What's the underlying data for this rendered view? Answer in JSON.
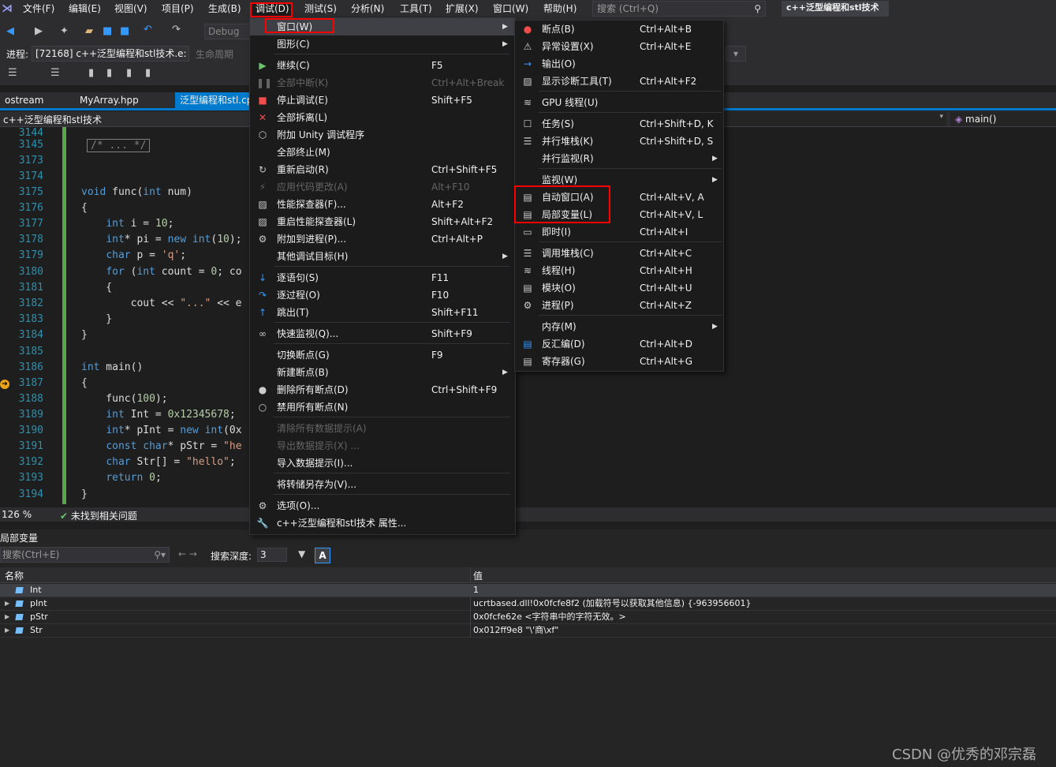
{
  "menubar": {
    "items": [
      "文件(F)",
      "编辑(E)",
      "视图(V)",
      "项目(P)",
      "生成(B)",
      "调试(D)",
      "测试(S)",
      "分析(N)",
      "工具(T)",
      "扩展(X)",
      "窗口(W)",
      "帮助(H)"
    ],
    "search_placeholder": "搜索 (Ctrl+Q)",
    "title": "c++泛型编程和stl技术"
  },
  "toolbar": {
    "config": "Debug",
    "process_label": "进程:",
    "process_value": "[72168] c++泛型编程和stl技术.e:",
    "lifecycle": "生命周期"
  },
  "tabs": [
    "ostream",
    "MyArray.hpp",
    "泛型编程和stl.cp"
  ],
  "nav": {
    "left": "c++泛型编程和stl技术",
    "right": "main()"
  },
  "editor": {
    "lines": [
      {
        "n": "3144",
        "t": ""
      },
      {
        "n": "3145",
        "t": "/* ... */"
      },
      {
        "n": "3173",
        "t": ""
      },
      {
        "n": "3174",
        "t": ""
      },
      {
        "n": "3175",
        "t": "void func(int num)"
      },
      {
        "n": "3176",
        "t": "{"
      },
      {
        "n": "3177",
        "t": "    int i = 10;"
      },
      {
        "n": "3178",
        "t": "    int* pi = new int(10);"
      },
      {
        "n": "3179",
        "t": "    char p = 'q';"
      },
      {
        "n": "3180",
        "t": "    for (int count = 0; co"
      },
      {
        "n": "3181",
        "t": "    {"
      },
      {
        "n": "3182",
        "t": "        cout << \"...\" << e"
      },
      {
        "n": "3183",
        "t": "    }"
      },
      {
        "n": "3184",
        "t": "}"
      },
      {
        "n": "3185",
        "t": ""
      },
      {
        "n": "3186",
        "t": "int main()"
      },
      {
        "n": "3187",
        "t": "{"
      },
      {
        "n": "3188",
        "t": "    func(100);"
      },
      {
        "n": "3189",
        "t": "    int Int = 0x12345678;"
      },
      {
        "n": "3190",
        "t": "    int* pInt = new int(0x"
      },
      {
        "n": "3191",
        "t": "    const char* pStr = \"he"
      },
      {
        "n": "3192",
        "t": "    char Str[] = \"hello\";"
      },
      {
        "n": "3193",
        "t": "    return 0;"
      },
      {
        "n": "3194",
        "t": "}"
      }
    ]
  },
  "status": {
    "zoom": "126 %",
    "issues": "未找到相关问题"
  },
  "panel": {
    "title": "局部变量",
    "search_placeholder": "搜索(Ctrl+E)",
    "depth_label": "搜索深度:",
    "depth_value": "3",
    "col_name": "名称",
    "col_value": "值",
    "rows": [
      {
        "name": "Int",
        "value": "1"
      },
      {
        "name": "pInt",
        "value": "ucrtbased.dll!0x0fcfe8f2 (加载符号以获取其他信息) {-963956601}"
      },
      {
        "name": "pStr",
        "value": "0x0fcfe62e <字符串中的字符无效。>"
      },
      {
        "name": "Str",
        "value": "0x012ff9e8 \"\\'商\\xf\""
      }
    ]
  },
  "debug_menu": {
    "items": [
      {
        "label": "窗口(W)",
        "sc": "",
        "dis": false,
        "sub": true
      },
      {
        "label": "图形(C)",
        "sc": "",
        "dis": false,
        "sub": true
      },
      {
        "label": "继续(C)",
        "sc": "F5",
        "dis": false
      },
      {
        "label": "全部中断(K)",
        "sc": "Ctrl+Alt+Break",
        "dis": true
      },
      {
        "label": "停止调试(E)",
        "sc": "Shift+F5",
        "dis": false
      },
      {
        "label": "全部拆离(L)",
        "sc": "",
        "dis": false
      },
      {
        "label": "附加 Unity 调试程序",
        "sc": "",
        "dis": false
      },
      {
        "label": "全部终止(M)",
        "sc": "",
        "dis": false
      },
      {
        "label": "重新启动(R)",
        "sc": "Ctrl+Shift+F5",
        "dis": false
      },
      {
        "label": "应用代码更改(A)",
        "sc": "Alt+F10",
        "dis": true
      },
      {
        "label": "性能探查器(F)...",
        "sc": "Alt+F2",
        "dis": false
      },
      {
        "label": "重启性能探查器(L)",
        "sc": "Shift+Alt+F2",
        "dis": false
      },
      {
        "label": "附加到进程(P)...",
        "sc": "Ctrl+Alt+P",
        "dis": false
      },
      {
        "label": "其他调试目标(H)",
        "sc": "",
        "dis": false,
        "sub": true
      },
      {
        "label": "逐语句(S)",
        "sc": "F11",
        "dis": false
      },
      {
        "label": "逐过程(O)",
        "sc": "F10",
        "dis": false
      },
      {
        "label": "跳出(T)",
        "sc": "Shift+F11",
        "dis": false
      },
      {
        "label": "快速监视(Q)...",
        "sc": "Shift+F9",
        "dis": false
      },
      {
        "label": "切换断点(G)",
        "sc": "F9",
        "dis": false
      },
      {
        "label": "新建断点(B)",
        "sc": "",
        "dis": false,
        "sub": true
      },
      {
        "label": "删除所有断点(D)",
        "sc": "Ctrl+Shift+F9",
        "dis": false
      },
      {
        "label": "禁用所有断点(N)",
        "sc": "",
        "dis": false
      },
      {
        "label": "清除所有数据提示(A)",
        "sc": "",
        "dis": true
      },
      {
        "label": "导出数据提示(X) ...",
        "sc": "",
        "dis": true
      },
      {
        "label": "导入数据提示(I)...",
        "sc": "",
        "dis": false
      },
      {
        "label": "将转储另存为(V)...",
        "sc": "",
        "dis": false
      },
      {
        "label": "选项(O)...",
        "sc": "",
        "dis": false
      },
      {
        "label": "c++泛型编程和stl技术 属性...",
        "sc": "",
        "dis": false
      }
    ]
  },
  "window_menu": {
    "items": [
      {
        "label": "断点(B)",
        "sc": "Ctrl+Alt+B"
      },
      {
        "label": "异常设置(X)",
        "sc": "Ctrl+Alt+E"
      },
      {
        "label": "输出(O)",
        "sc": ""
      },
      {
        "label": "显示诊断工具(T)",
        "sc": "Ctrl+Alt+F2"
      },
      {
        "label": "GPU 线程(U)",
        "sc": ""
      },
      {
        "label": "任务(S)",
        "sc": "Ctrl+Shift+D, K"
      },
      {
        "label": "并行堆栈(K)",
        "sc": "Ctrl+Shift+D, S"
      },
      {
        "label": "并行监视(R)",
        "sc": "",
        "sub": true
      },
      {
        "label": "监视(W)",
        "sc": "",
        "sub": true
      },
      {
        "label": "自动窗口(A)",
        "sc": "Ctrl+Alt+V, A"
      },
      {
        "label": "局部变量(L)",
        "sc": "Ctrl+Alt+V, L"
      },
      {
        "label": "即时(I)",
        "sc": "Ctrl+Alt+I"
      },
      {
        "label": "调用堆栈(C)",
        "sc": "Ctrl+Alt+C"
      },
      {
        "label": "线程(H)",
        "sc": "Ctrl+Alt+H"
      },
      {
        "label": "模块(O)",
        "sc": "Ctrl+Alt+U"
      },
      {
        "label": "进程(P)",
        "sc": "Ctrl+Alt+Z"
      },
      {
        "label": "内存(M)",
        "sc": "",
        "sub": true
      },
      {
        "label": "反汇编(D)",
        "sc": "Ctrl+Alt+D"
      },
      {
        "label": "寄存器(G)",
        "sc": "Ctrl+Alt+G"
      }
    ]
  },
  "watermark": "CSDN @优秀的邓宗磊"
}
